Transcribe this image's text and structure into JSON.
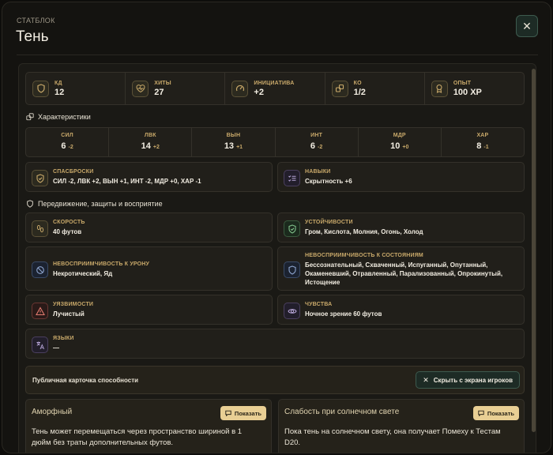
{
  "header": {
    "subtitle": "СТАТБЛОК",
    "title": "Тень",
    "close_icon": "close-icon"
  },
  "stats": [
    {
      "label": "КД",
      "value": "12",
      "icon": "shield-icon"
    },
    {
      "label": "ХИТЫ",
      "value": "27",
      "icon": "heart-pulse-icon"
    },
    {
      "label": "ИНИЦИАТИВА",
      "value": "+2",
      "icon": "gauge-icon"
    },
    {
      "label": "КО",
      "value": "1/2",
      "icon": "swords-icon"
    },
    {
      "label": "ОПЫТ",
      "value": "100 XP",
      "icon": "award-icon"
    }
  ],
  "characteristics": {
    "title": "Характеристики",
    "items": [
      {
        "label": "СИЛ",
        "score": "6",
        "mod": "-2"
      },
      {
        "label": "ЛВК",
        "score": "14",
        "mod": "+2"
      },
      {
        "label": "ВЫН",
        "score": "13",
        "mod": "+1"
      },
      {
        "label": "ИНТ",
        "score": "6",
        "mod": "-2"
      },
      {
        "label": "МДР",
        "score": "10",
        "mod": "+0"
      },
      {
        "label": "ХАР",
        "score": "8",
        "mod": "-1"
      }
    ]
  },
  "saves": {
    "label": "СПАСБРОСКИ",
    "value": "СИЛ -2, ЛВК +2, ВЫН +1, ИНТ -2, МДР +0, ХАР -1"
  },
  "skills": {
    "label": "НАВЫКИ",
    "value": "Скрытность +6"
  },
  "defenses": {
    "title": "Передвижение, защиты и восприятие",
    "speed": {
      "label": "СКОРОСТЬ",
      "value": "40 футов"
    },
    "resistances": {
      "label": "УСТОЙЧИВОСТИ",
      "value": "Гром, Кислота, Молния, Огонь, Холод"
    },
    "damage_immunities": {
      "label": "НЕВОСПРИИМЧИВОСТЬ К УРОНУ",
      "value": "Некротический, Яд"
    },
    "condition_immunities": {
      "label": "НЕВОСПРИИМЧИВОСТЬ К СОСТОЯНИЯМ",
      "value": "Бессознательный, Схваченный, Испуганный, Опутанный, Окаменевший, Отравленный, Парализованный, Опрокинутый, Истощение"
    },
    "vulnerabilities": {
      "label": "УЯЗВИМОСТИ",
      "value": "Лучистый"
    },
    "senses": {
      "label": "ЧУВСТВА",
      "value": "Ночное зрение 60 футов"
    },
    "languages": {
      "label": "ЯЗЫКИ",
      "value": "—"
    }
  },
  "public_card": {
    "title": "Публичная карточка способности",
    "hide_label": "Скрыть с экрана игроков"
  },
  "abilities": [
    {
      "title": "Аморфный",
      "button": "Показать",
      "text": "Тень может перемещаться через пространство шириной в 1 дюйм без траты дополнительных футов."
    },
    {
      "title": "Слабость при солнечном свете",
      "button": "Показать",
      "text": "Пока тень на солнечном свету, она получает Помеху к Тестам D20."
    }
  ],
  "colors": {
    "accent": "#c9a96a",
    "button": "#e9cf94",
    "close_border": "#3d5a4e"
  }
}
